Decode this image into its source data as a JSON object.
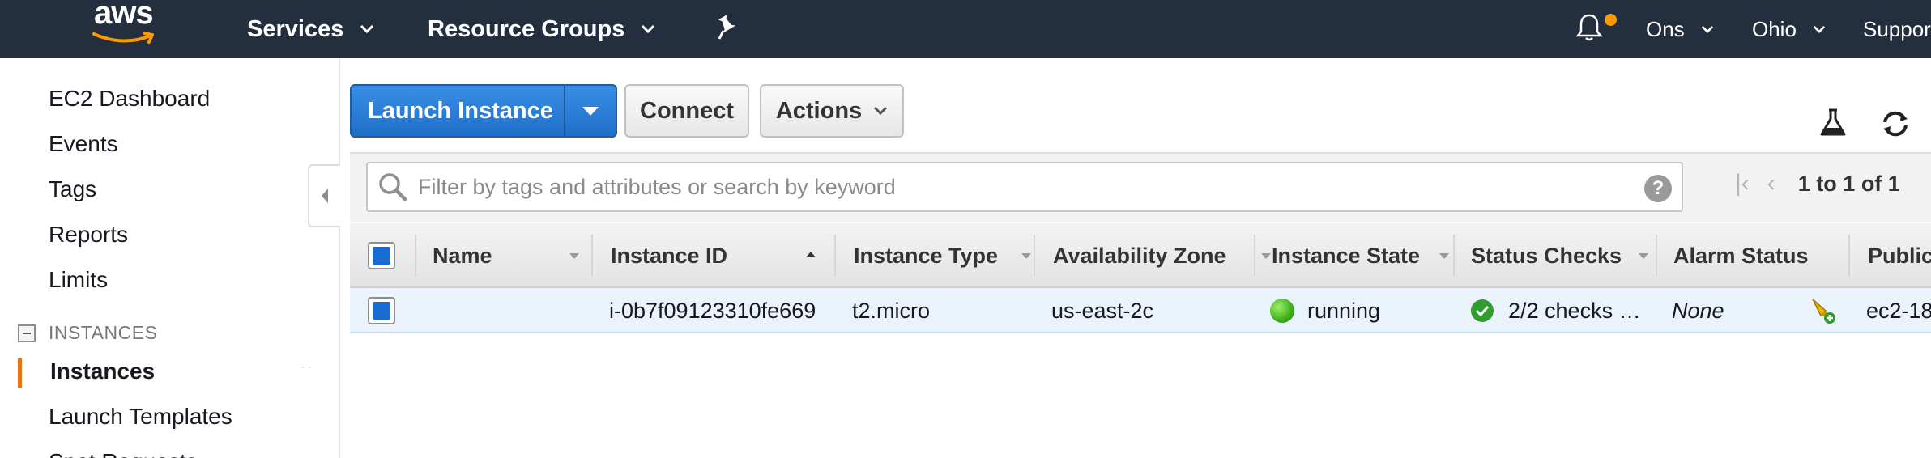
{
  "topbar": {
    "logo_text": "aws",
    "services_label": "Services",
    "resource_groups_label": "Resource Groups",
    "account_label": "Ons",
    "region_label": "Ohio",
    "support_label": "Suppor",
    "notification_color": "#ff9900",
    "background_color": "#232f3e"
  },
  "sidebar": {
    "items": [
      {
        "label": "EC2 Dashboard"
      },
      {
        "label": "Events"
      },
      {
        "label": "Tags"
      },
      {
        "label": "Reports"
      },
      {
        "label": "Limits"
      }
    ],
    "section_label": "INSTANCES",
    "section_items": [
      {
        "label": "Instances",
        "active": true
      },
      {
        "label": "Launch Templates",
        "active": false
      },
      {
        "label": "Spot Requests",
        "active": false
      }
    ],
    "active_color": "#ec7211"
  },
  "toolbar": {
    "launch_label": "Launch Instance",
    "connect_label": "Connect",
    "actions_label": "Actions"
  },
  "filter": {
    "placeholder": "Filter by tags and attributes or search by keyword",
    "help_label": "?",
    "pagination_text": "1 to 1 of 1"
  },
  "table": {
    "columns": [
      {
        "label": "Name"
      },
      {
        "label": "Instance ID"
      },
      {
        "label": "Instance Type"
      },
      {
        "label": "Availability Zone"
      },
      {
        "label": "Instance State"
      },
      {
        "label": "Status Checks"
      },
      {
        "label": "Alarm Status"
      },
      {
        "label": "Public"
      }
    ],
    "rows": [
      {
        "name": "",
        "instance_id": "i-0b7f09123310fe669",
        "instance_type": "t2.micro",
        "availability_zone": "us-east-2c",
        "instance_state": "running",
        "status_checks": "2/2 checks …",
        "alarm_status": "None",
        "public": "ec2-18"
      }
    ]
  },
  "icons": {
    "notification": "bell-icon",
    "pin": "pin-icon",
    "search": "magnifier-icon",
    "flask": "flask-icon",
    "refresh": "refresh-icon",
    "state": "green-dot-icon",
    "status_ok": "check-circle-icon",
    "alarm": "bell-plus-icon"
  }
}
